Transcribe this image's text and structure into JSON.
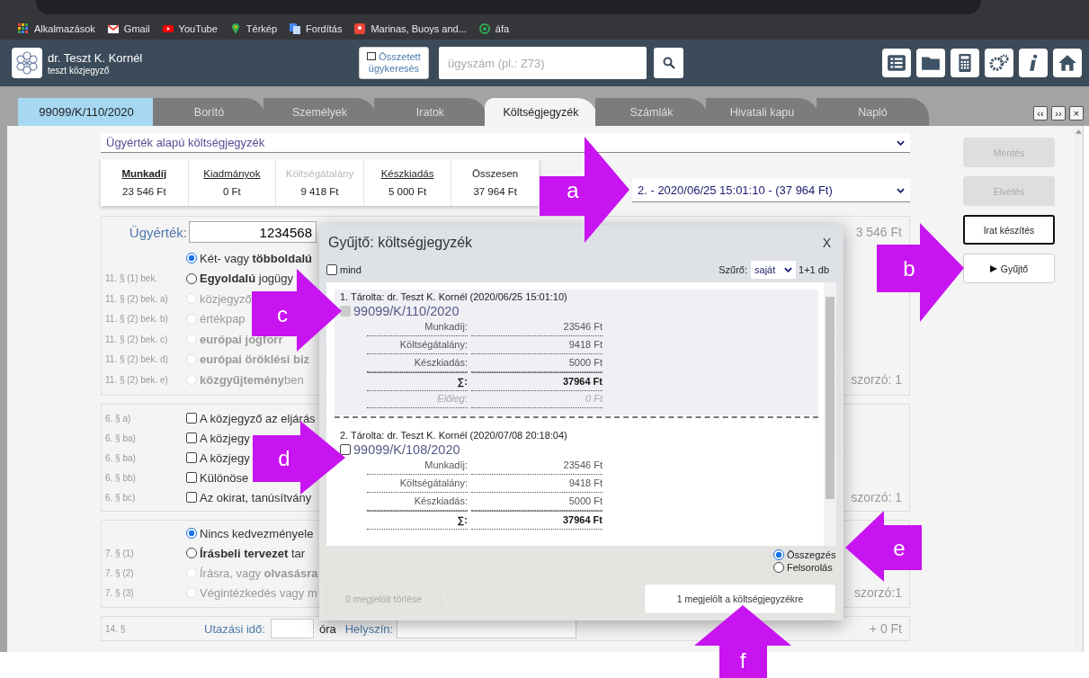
{
  "bookmarks": [
    {
      "label": "Alkalmazások"
    },
    {
      "label": "Gmail"
    },
    {
      "label": "YouTube"
    },
    {
      "label": "Térkép"
    },
    {
      "label": "Fordítás"
    },
    {
      "label": "Marinas, Buoys and..."
    },
    {
      "label": "áfa"
    }
  ],
  "header": {
    "user_name": "dr. Teszt K. Kornél",
    "user_role": "teszt közjegyző",
    "compound_search": "Összetett ügykeresés",
    "search": {
      "placeholder": "ügyszám (pl.: Z73)"
    }
  },
  "tabs": [
    {
      "label": "99099/K/110/2020",
      "kind": "case",
      "selected": false
    },
    {
      "label": "Borító",
      "kind": "page",
      "selected": false
    },
    {
      "label": "Személyek",
      "kind": "page",
      "selected": false
    },
    {
      "label": "Iratok",
      "kind": "page",
      "selected": false
    },
    {
      "label": "Költségjegyzék",
      "kind": "page",
      "selected": true
    },
    {
      "label": "Számlák",
      "kind": "page",
      "selected": false
    },
    {
      "label": "Hivatali kapu",
      "kind": "page",
      "selected": false
    },
    {
      "label": "Napló",
      "kind": "page",
      "selected": false
    }
  ],
  "tab_nav": [
    "‹‹",
    "››",
    "×"
  ],
  "cost_type": "Ügyérték alapú költségjegyzék",
  "summary": [
    {
      "label": "Munkadíj",
      "value": "23 546 Ft",
      "kind": "link",
      "selected": true,
      "disabled": false
    },
    {
      "label": "Kiadmányok",
      "value": "0 Ft",
      "kind": "link",
      "selected": false,
      "disabled": false
    },
    {
      "label": "Költségátalány",
      "value": "9 418 Ft",
      "kind": "link",
      "selected": false,
      "disabled": true
    },
    {
      "label": "Készkiadás",
      "value": "5 000 Ft",
      "kind": "link",
      "selected": false,
      "disabled": false
    },
    {
      "label": "Összesen",
      "value": "37 964 Ft",
      "kind": "total",
      "selected": false,
      "disabled": false
    }
  ],
  "version": "2. - 2020/06/25 15:01:10 - (37 964 Ft)",
  "actions": [
    {
      "label": "Mentés",
      "disabled": true,
      "focused": false,
      "kind": "plain"
    },
    {
      "label": "Elvetés",
      "disabled": true,
      "focused": false,
      "kind": "plain"
    },
    {
      "label": "Irat készítés",
      "disabled": false,
      "focused": true,
      "kind": "plain"
    },
    {
      "label": "Gyűjtő",
      "disabled": false,
      "focused": false,
      "kind": "play"
    }
  ],
  "value_group": {
    "label": "Ügyérték:",
    "value": "1234568",
    "amount": "3 546 Ft",
    "multiplier": "szorzó: 1",
    "options": [
      {
        "text": "Két- vagy **többoldalú**",
        "selected": true,
        "disabled": false
      },
      {
        "section": "11. § (1) bek.",
        "text": "**Egyoldalú** jogügy",
        "selected": false,
        "disabled": false
      },
      {
        "section": "11. § (2) bek. a)",
        "text": "közjegyző",
        "selected": false,
        "disabled": true
      },
      {
        "section": "11. § (2) bek. b)",
        "text": "értékpap",
        "selected": false,
        "disabled": true
      },
      {
        "section": "11. § (2) bek. c)",
        "text": "**európai jogforr**",
        "selected": false,
        "disabled": true
      },
      {
        "section": "11. § (2) bek. d)",
        "text": "**európai öröklési biz**",
        "selected": false,
        "disabled": true
      },
      {
        "section": "11. § (2) bek. e)",
        "text": "**közgyűjtemény**ben",
        "selected": false,
        "disabled": true
      }
    ]
  },
  "check_group": {
    "multiplier": "szorzó: 1",
    "options": [
      {
        "section": "6. § a)",
        "text": "A közjegyző az eljárás",
        "checked": false
      },
      {
        "section": "6. § ba)",
        "text": "A közjegy",
        "checked": false
      },
      {
        "section": "6. § ba)",
        "text": "A közjegy",
        "checked": false
      },
      {
        "section": "6. § bb)",
        "text": "Különöse",
        "checked": false
      },
      {
        "section": "6. § bc)",
        "text": "Az okirat, tanúsítvány",
        "checked": false
      }
    ]
  },
  "discount_group": {
    "multiplier": "szorzó:1",
    "options": [
      {
        "text": "Nincs kedvezményele",
        "selected": true,
        "disabled": false
      },
      {
        "section": "7. § (1)",
        "text": "**Írásbeli tervezet** tar",
        "selected": false,
        "disabled": false
      },
      {
        "section": "7. § (2)",
        "text": "Írásra, vagy **olvasásra**",
        "selected": false,
        "disabled": true
      },
      {
        "section": "7. § (3)",
        "text": "Végintézkedés vagy m",
        "selected": false,
        "disabled": true
      }
    ]
  },
  "travel": {
    "section": "14. §",
    "label": "Utazási idő:",
    "unit": "óra",
    "place_label": "Helyszín:",
    "amount": "+ 0 Ft"
  },
  "dialog": {
    "title": "Gyűjtő: költségjegyzék",
    "close": "X",
    "all": {
      "label": "mind",
      "checked": false
    },
    "filter_label": "Szűrő:",
    "filter_value": "saját",
    "count": "1+1 db",
    "entries": [
      {
        "header": "1. Tárolta: dr. Teszt K. Kornél (2020/06/25 15:01:10)",
        "case": "99099/K/110/2020",
        "checked": true,
        "disabled": true,
        "rows": [
          {
            "label": "Munkadíj:",
            "value": "23546 Ft",
            "kind": "item"
          },
          {
            "label": "Költségátalány:",
            "value": "9418 Ft",
            "kind": "item"
          },
          {
            "label": "Készkiadás:",
            "value": "5000 Ft",
            "kind": "item"
          },
          {
            "label": "∑:",
            "value": "37964 Ft",
            "kind": "sum"
          },
          {
            "label": "Előleg:",
            "value": "0 Ft",
            "kind": "advance"
          }
        ]
      },
      {
        "header": "2. Tárolta: dr. Teszt K. Kornél (2020/07/08 20:18:04)",
        "case": "99099/K/108/2020",
        "checked": false,
        "disabled": false,
        "rows": [
          {
            "label": "Munkadíj:",
            "value": "23546 Ft",
            "kind": "item"
          },
          {
            "label": "Költségátalány:",
            "value": "9418 Ft",
            "kind": "item"
          },
          {
            "label": "Készkiadás:",
            "value": "5000 Ft",
            "kind": "item"
          },
          {
            "label": "∑:",
            "value": "37964 Ft",
            "kind": "sum"
          }
        ]
      }
    ],
    "modes": [
      {
        "label": "Összegzés",
        "selected": true
      },
      {
        "label": "Felsorolás",
        "selected": false
      }
    ],
    "buttons": [
      {
        "label": "0 megjelölt törlése",
        "disabled": true
      },
      {
        "label": "1 megjelölt a költségjegyzékre",
        "disabled": false
      }
    ]
  },
  "callouts": [
    "a",
    "b",
    "c",
    "d",
    "e",
    "f"
  ]
}
